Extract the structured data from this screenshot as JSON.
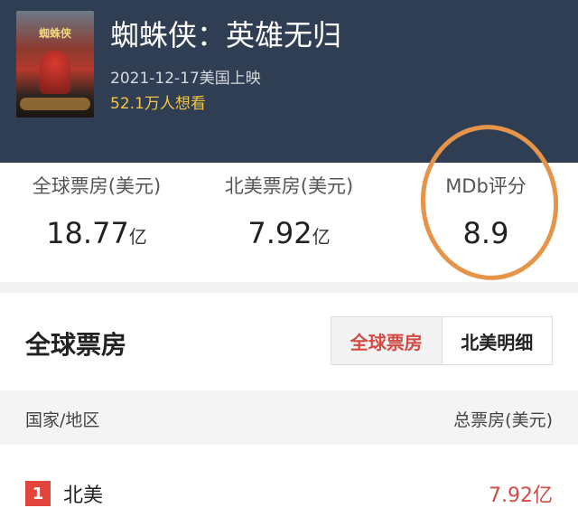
{
  "movie": {
    "poster_title": "蜘蛛侠",
    "title": "蜘蛛侠：英雄无归",
    "release": "2021-12-17美国上映",
    "want_to_see": "52.1万人想看"
  },
  "stats": [
    {
      "label": "全球票房(美元)",
      "value": "18.77",
      "unit": "亿"
    },
    {
      "label": "北美票房(美元)",
      "value": "7.92",
      "unit": "亿"
    },
    {
      "label": "MDb评分",
      "value": "8.9",
      "unit": ""
    }
  ],
  "box_office": {
    "title": "全球票房",
    "tabs": [
      "全球票房",
      "北美明细"
    ],
    "active_tab": 0,
    "columns": [
      "国家/地区",
      "总票房(美元)"
    ],
    "rows": [
      {
        "rank": "1",
        "region": "北美",
        "amount": "7.92亿"
      }
    ]
  },
  "colors": {
    "header_bg": "#2f3e52",
    "accent_red": "#d14b45",
    "want_yellow": "#f3c648",
    "annotation_circle": "#e7944b"
  }
}
